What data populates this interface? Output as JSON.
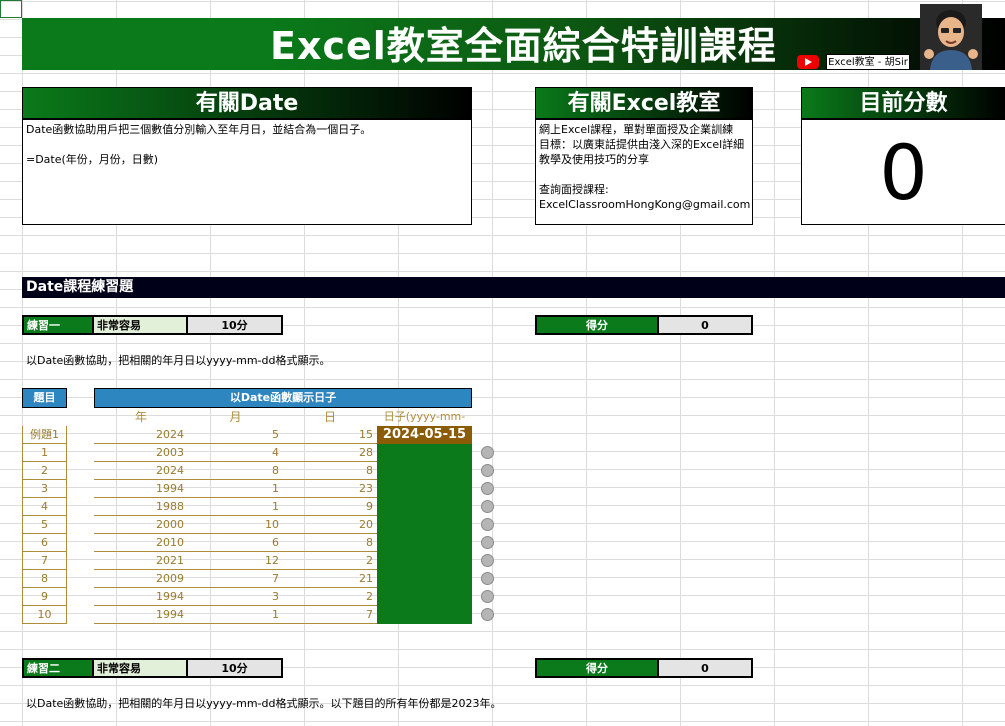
{
  "banner": {
    "title": "Excel教室全面綜合特訓課程",
    "channel": "Excel教室 - 胡Sir"
  },
  "date_box": {
    "header": "有關Date",
    "lines": "Date函數協助用戶把三個數值分別輸入至年月日，並結合為一個日子。\n\n=Date(年份，月份，日數)"
  },
  "excel_box": {
    "header": "有關Excel教室",
    "lines": "網上Excel課程，單對單面授及企業訓練\n目標：以廣東話提供由淺入深的Excel詳細教學及使用技巧的分享\n\n查詢面授課程:\nExcelClassroomHongKong@gmail.com"
  },
  "score_box": {
    "header": "目前分數",
    "value": "0"
  },
  "section_title": "Date課程練習題",
  "exercise1": {
    "label": "練習一",
    "difficulty": "非常容易",
    "points": "10分",
    "score_label": "得分",
    "score": "0",
    "instruction": "以Date函數協助，把相關的年月日以yyyy-mm-dd格式顯示。"
  },
  "table": {
    "q_header": "題目",
    "group_header": "以Date函數顯示日子",
    "col_year": "年",
    "col_month": "月",
    "col_day": "日",
    "col_result": "日子(yyyy-mm-dd)",
    "example": {
      "idx": "例題1",
      "year": "2024",
      "month": "5",
      "day": "15",
      "result": "2024-05-15"
    },
    "rows": [
      {
        "idx": "1",
        "year": "2003",
        "month": "4",
        "day": "28"
      },
      {
        "idx": "2",
        "year": "2024",
        "month": "8",
        "day": "8"
      },
      {
        "idx": "3",
        "year": "1994",
        "month": "1",
        "day": "23"
      },
      {
        "idx": "4",
        "year": "1988",
        "month": "1",
        "day": "9"
      },
      {
        "idx": "5",
        "year": "2000",
        "month": "10",
        "day": "20"
      },
      {
        "idx": "6",
        "year": "2010",
        "month": "6",
        "day": "8"
      },
      {
        "idx": "7",
        "year": "2021",
        "month": "12",
        "day": "2"
      },
      {
        "idx": "8",
        "year": "2009",
        "month": "7",
        "day": "21"
      },
      {
        "idx": "9",
        "year": "1994",
        "month": "3",
        "day": "2"
      },
      {
        "idx": "10",
        "year": "1994",
        "month": "1",
        "day": "7"
      }
    ]
  },
  "exercise2": {
    "label": "練習二",
    "difficulty": "非常容易",
    "points": "10分",
    "score_label": "得分",
    "score": "0",
    "instruction": "以Date函數協助，把相關的年月日以yyyy-mm-dd格式顯示。以下題目的所有年份都是2023年。"
  },
  "colors": {
    "green": "#0a7a1a",
    "blue": "#2e86c1",
    "gold": "#8a5c05"
  }
}
